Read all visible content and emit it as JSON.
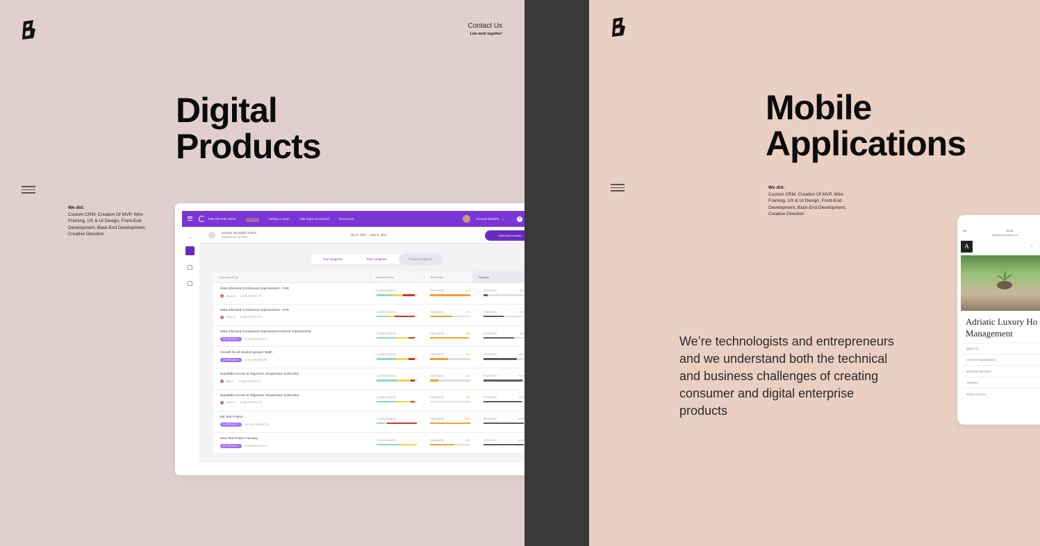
{
  "left": {
    "contact_label": "Contact Us",
    "contact_sub": "Lets work together!",
    "headline_line1": "Digital",
    "headline_line2": "Products",
    "wedid_label": "We did:",
    "wedid_text": "Custom CRM, Creation Of MVP, Wire Framing, UX & UI Design, Front-End Development, Back-End Development, Creative Direction",
    "dashboard": {
      "brand": "THE ON THE GOAL",
      "nav": [
        "Overview",
        "Setting in done",
        "Vital Signs Scorecard",
        "Resources"
      ],
      "user_name": "Account Brokers",
      "school_name": "Kosnan rds public school",
      "school_sub": "Members on the team",
      "date_range": "Oct 5, 2017 – Nov 6, 2017",
      "invite_label": "Add team member",
      "tabs": [
        "Your progress",
        "Team progress",
        "Project progress"
      ],
      "col_headers": [
        "Sort projects by",
        "Completeness",
        "Timeliness",
        "Progress"
      ],
      "bar_labels": {
        "comp": "COMPLETENESS",
        "time": "TIMELINESS",
        "prog": "PROGRESS"
      },
      "rows": [
        {
          "name": "Data Informed Continuous Improvement - FAR",
          "owner": "Jenny R.",
          "sub": "4 SUB PROJECTS",
          "badge": "",
          "time_pct": "80%",
          "prog_pct": "11%",
          "comp": 0.95,
          "comp_red": 0.3,
          "time": 1.0,
          "prog": 0.11
        },
        {
          "name": "Data Informed Continuous Improvement - FAR",
          "owner": "Jenny R.",
          "sub": "4 SUB PROJECTS",
          "badge": "",
          "time_pct": "47%",
          "prog_pct": "46%",
          "comp": 0.95,
          "comp_red": 0.5,
          "time": 0.55,
          "prog": 0.5
        },
        {
          "name": "Data Informed Continuous Improvement School Improvement",
          "owner": "",
          "sub": "2 SUB PROJECTS",
          "badge": "MY PROJECT",
          "time_pct": "80%",
          "prog_pct": "76%",
          "comp": 0.95,
          "comp_red": 0.15,
          "time": 0.95,
          "prog": 0.76
        },
        {
          "name": "Growth for all student groups: Math",
          "owner": "",
          "sub": "4 SUB PROJECTS",
          "badge": "MY PROJECT",
          "time_pct": "40%",
          "prog_pct": "82%",
          "comp": 0.95,
          "comp_red": 0.15,
          "time": 0.45,
          "prog": 0.82
        },
        {
          "name": "Equitable Access to Rigorous, Responsive Instruction",
          "owner": "Mark S.",
          "sub": "2 SUB PROJECTS",
          "badge": "",
          "time_pct": "15%",
          "prog_pct": "97%",
          "comp": 0.95,
          "comp_red": 0.1,
          "time": 0.2,
          "prog": 0.97
        },
        {
          "name": "Equitable Access to Rigorous, Responsive Instruction",
          "owner": "Jenny R.",
          "sub": "3 SUB PROJECTS",
          "badge": "",
          "time_pct": "74%",
          "prog_pct": "95%",
          "comp": 0.95,
          "comp_red": 0.1,
          "time": 0.0,
          "prog": 0.95
        },
        {
          "name": "My Test Project",
          "owner": "",
          "sub": "16 SUB PROJECTS",
          "badge": "MY PROJECT",
          "time_pct": "100%",
          "prog_pct": "100%",
          "comp": 1.0,
          "comp_red": 0.75,
          "time": 1.0,
          "prog": 1.0
        },
        {
          "name": "New Test Project January",
          "owner": "",
          "sub": "3 SUB PROJECTS",
          "badge": "MY PROJECT",
          "time_pct": "57%",
          "prog_pct": "100%",
          "comp": 1.0,
          "comp_red": 0.0,
          "time": 0.6,
          "prog": 1.0
        }
      ]
    }
  },
  "right": {
    "headline_line1": "Mobile",
    "headline_line2": "Applications",
    "wedid_label": "We did:",
    "wedid_text": "Custom CRM, Creation Of MVP, Wire Framing, UX & UI Design, Front-End Development, Back-End Development, Creative Direction",
    "tagline": "We’re technologists and entrepreneurs and we understand both the technical and business challenges of creating consumer and digital enterprise products",
    "phone": {
      "carrier": "UK",
      "time": "10:42",
      "url": "adriaticluxuryhotels.com",
      "logo_letter": "A",
      "title_line1": "Adriatic Luxury Ho",
      "title_line2": "Management",
      "menu": [
        "ABOUT US",
        "CONTENT MANAGEMENT",
        "BUSINESS REPORTS",
        "TENDERS",
        "PRESS CLIPPING"
      ]
    }
  },
  "colors": {
    "left_bg": "#e1cfcf",
    "right_bg": "#eacfc3",
    "divider": "#393939",
    "accent_purple": "#7b35d4",
    "green": "#8fd9b6",
    "yellow": "#e6d94a",
    "red": "#c0392b",
    "orange": "#f0a030",
    "dark": "#555a66"
  }
}
